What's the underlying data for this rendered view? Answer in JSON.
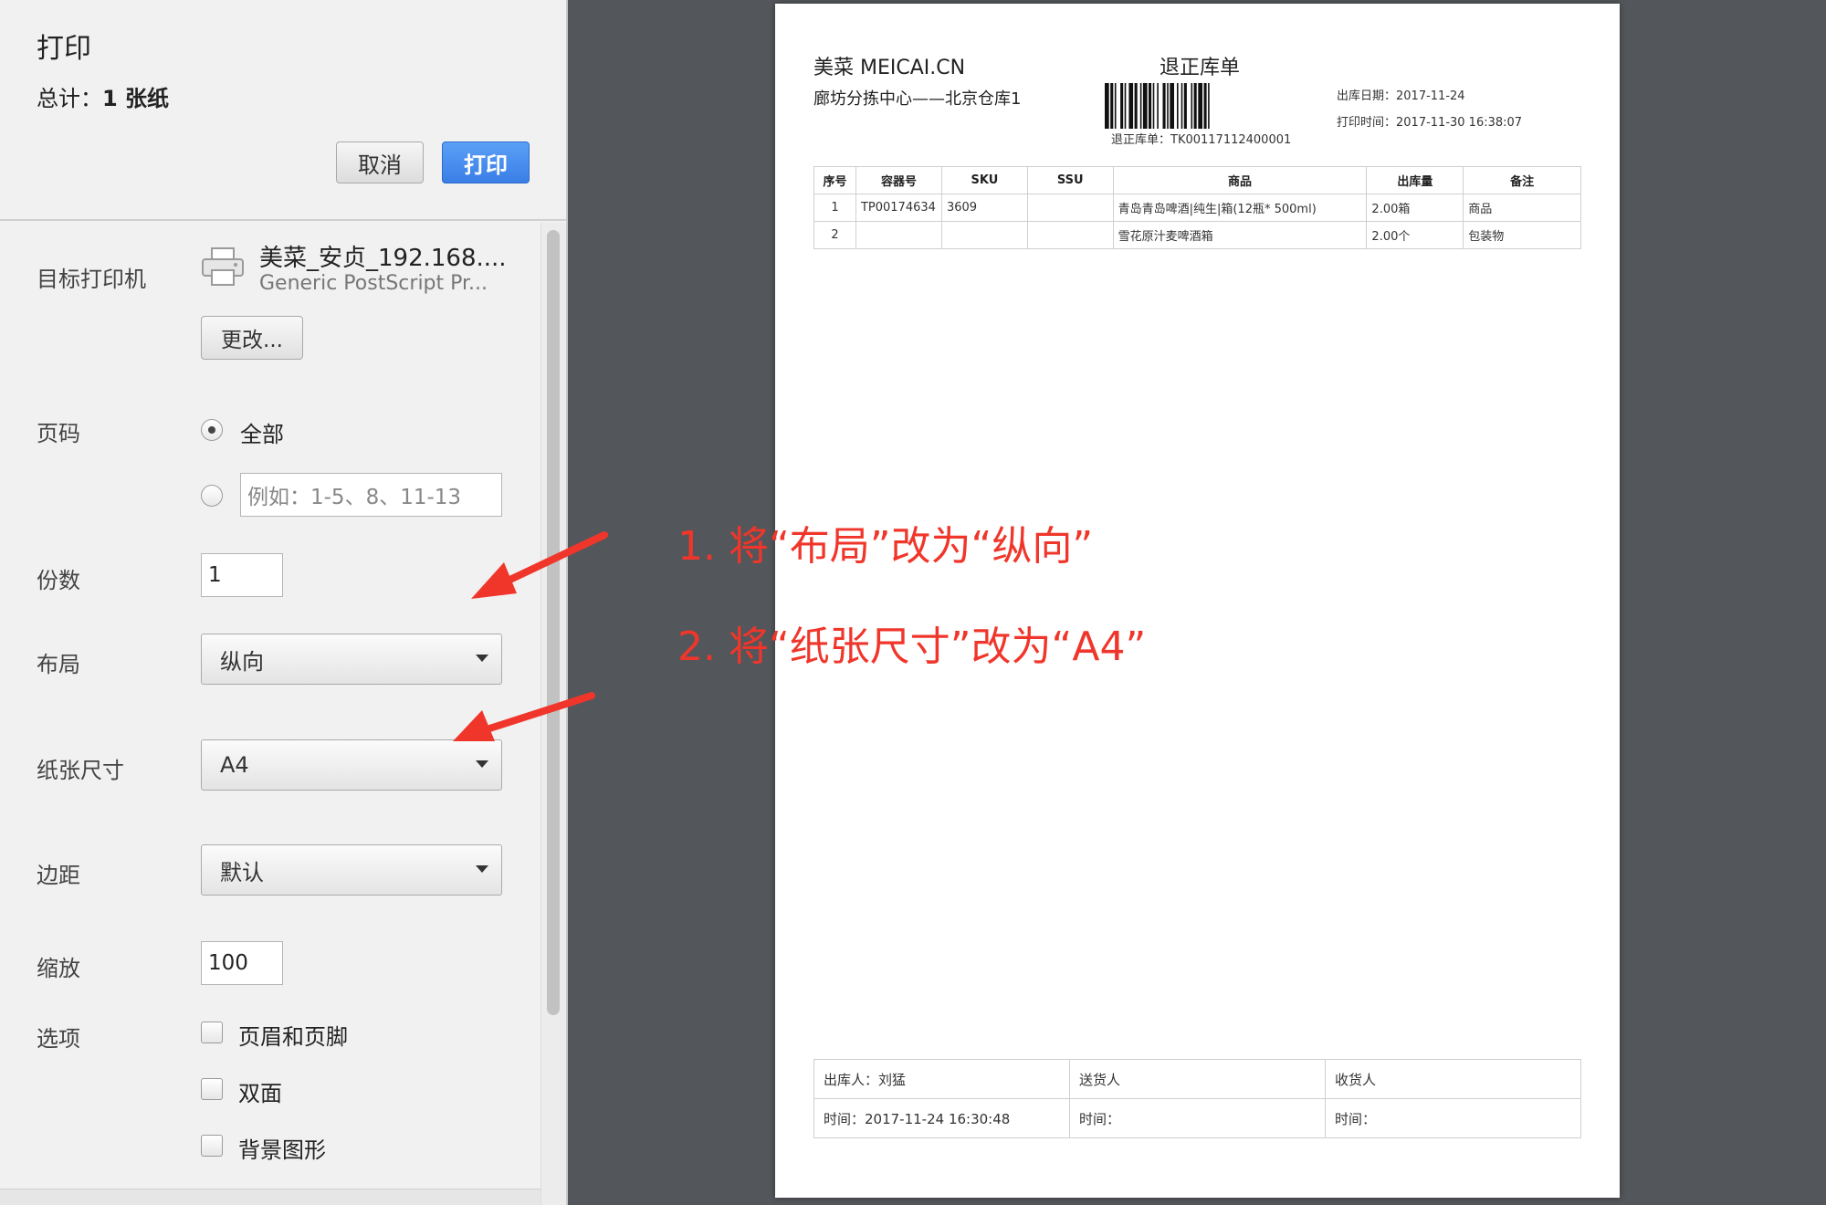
{
  "sidebar": {
    "title": "打印",
    "summary_label": "总计：",
    "summary_value": "1 张纸",
    "cancel_label": "取消",
    "print_label": "打印",
    "destination": {
      "label": "目标打印机",
      "printer_name": "美菜_安贞_192.168....",
      "printer_driver": "Generic PostScript Pr...",
      "change_label": "更改..."
    },
    "pages": {
      "label": "页码",
      "all_label": "全部",
      "custom_placeholder": "例如：1-5、8、11-13"
    },
    "copies": {
      "label": "份数",
      "value": "1"
    },
    "layout": {
      "label": "布局",
      "value": "纵向"
    },
    "paper_size": {
      "label": "纸张尺寸",
      "value": "A4"
    },
    "margins": {
      "label": "边距",
      "value": "默认"
    },
    "scale": {
      "label": "缩放",
      "value": "100"
    },
    "options": {
      "label": "选项",
      "items": [
        "页眉和页脚",
        "双面",
        "背景图形"
      ]
    }
  },
  "document": {
    "brand": "美菜 MEICAI.CN",
    "title": "退正库单",
    "center_name": "廊坊分拣中心——北京仓库1",
    "barcode_caption": "退正库单：TK00117112400001",
    "out_date": "出库日期：2017-11-24",
    "print_time": "打印时间：2017-11-30 16:38:07",
    "table": {
      "headers": [
        "序号",
        "容器号",
        "SKU",
        "SSU",
        "商品",
        "出库量",
        "备注"
      ],
      "rows": [
        [
          "1",
          "TP00174634",
          "3609",
          "",
          "青岛青岛啤酒|纯生|箱(12瓶* 500ml)",
          "2.00箱",
          "商品"
        ],
        [
          "2",
          "",
          "",
          "",
          "雪花原汁麦啤酒箱",
          "2.00个",
          "包装物"
        ]
      ]
    },
    "signatures": {
      "row1": [
        "出库人：刘猛",
        "送货人",
        "收货人"
      ],
      "row2": [
        "时间：2017-11-24 16:30:48",
        "时间：",
        "时间："
      ]
    }
  },
  "annotations": {
    "note1": "1. 将“布局”改为“纵向”",
    "note2": "2. 将“纸张尺寸”改为“A4”",
    "color": "#f0362b"
  },
  "colors": {
    "print_button": "#3a7ee6",
    "preview_background": "#53565a",
    "panel_background": "#f1f1f1"
  }
}
